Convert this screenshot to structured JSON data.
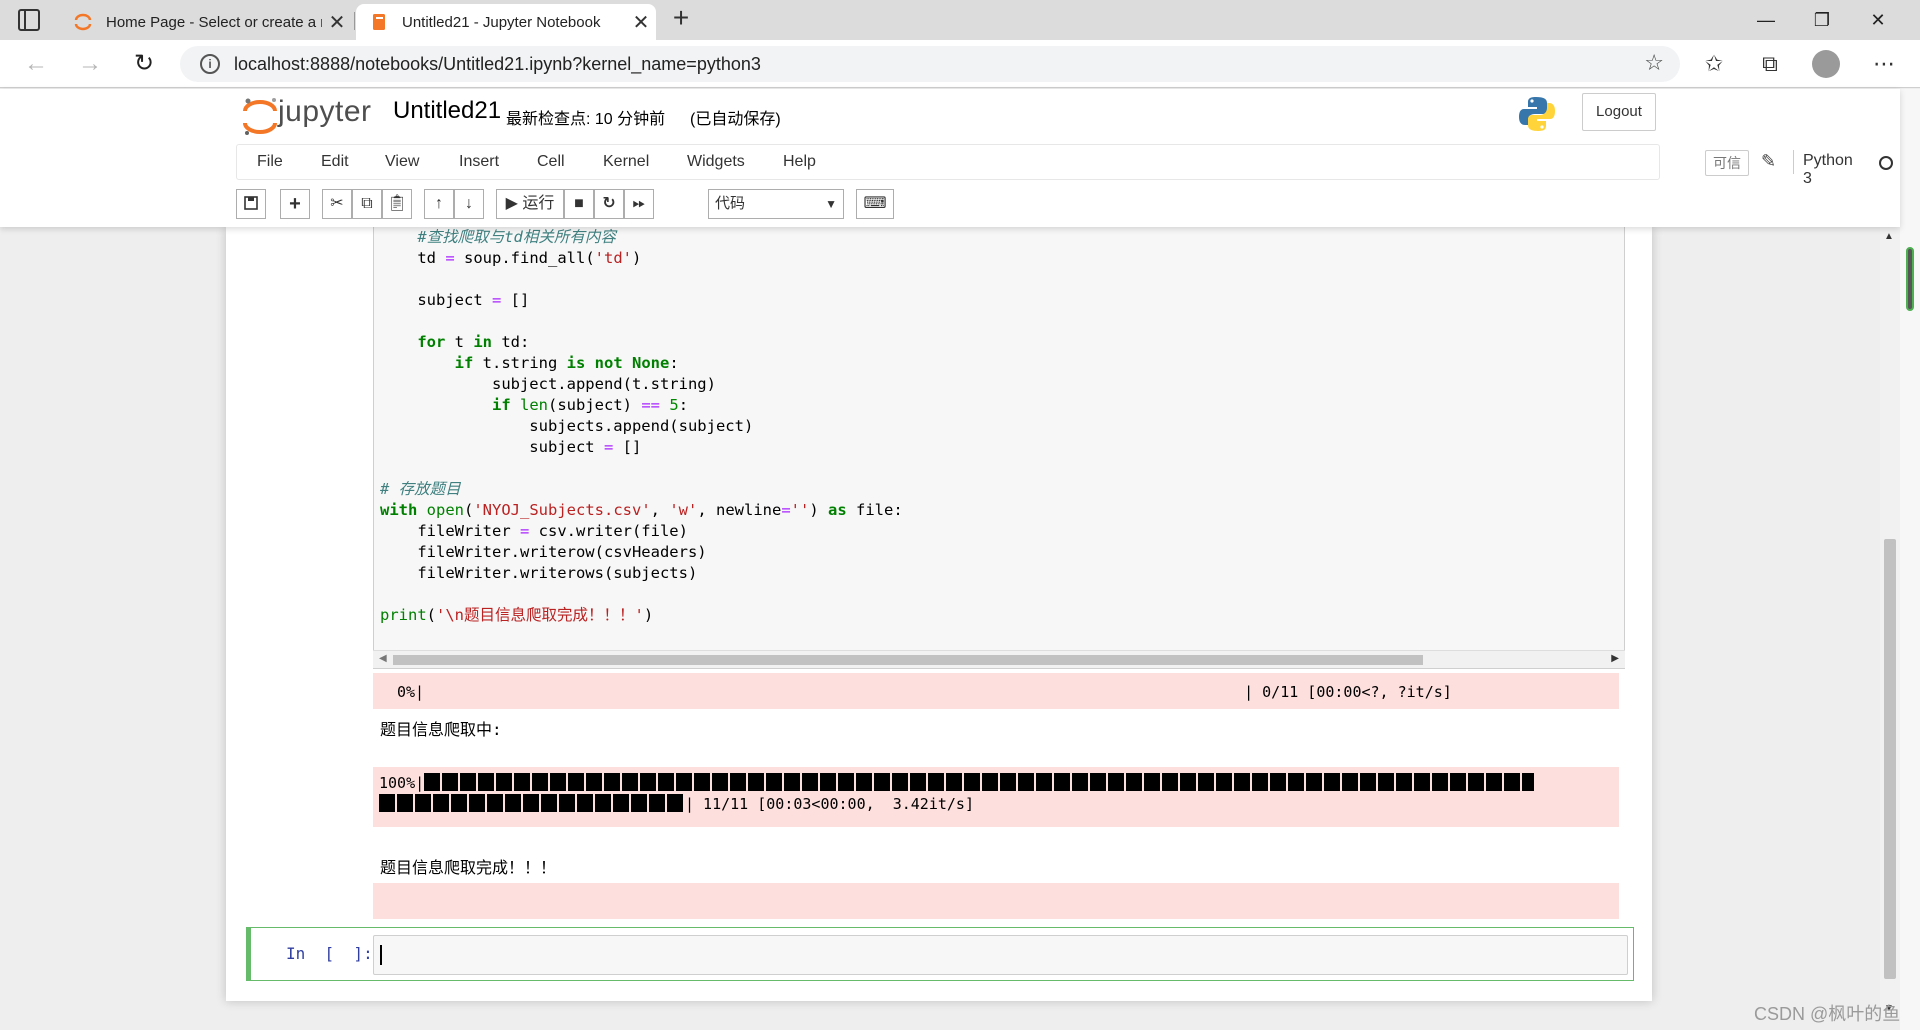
{
  "browser": {
    "tabs": [
      {
        "title": "Home Page - Select or create a n",
        "active": false
      },
      {
        "title": "Untitled21 - Jupyter Notebook",
        "active": true
      }
    ],
    "url": "localhost:8888/notebooks/Untitled21.ipynb?kernel_name=python3",
    "new_tab": "+",
    "close": "✕",
    "window_controls": {
      "minimize": "—",
      "maximize": "❐",
      "close": "✕"
    }
  },
  "jupyter": {
    "logo_text": "jupyter",
    "notebook_title": "Untitled21",
    "checkpoint": "最新检查点: 10 分钟前",
    "autosave": "(已自动保存)",
    "logout": "Logout",
    "menu": [
      "File",
      "Edit",
      "View",
      "Insert",
      "Cell",
      "Kernel",
      "Widgets",
      "Help"
    ],
    "trusted": "可信",
    "kernel": "Python 3",
    "toolbar": {
      "run_label": "运行",
      "cell_type": "代码"
    }
  },
  "cell": {
    "code_lines": [
      "#查找爬取与td相关所有内容",
      "td = soup.find_all('td')",
      "",
      "subject = []",
      "",
      "for t in td:",
      "    if t.string is not None:",
      "        subject.append(t.string)",
      "        if len(subject) == 5:",
      "            subjects.append(subject)",
      "            subject = []",
      "",
      "# 存放题目",
      "with open('NYOJ_Subjects.csv', 'w', newline='') as file:",
      "    fileWriter = csv.writer(file)",
      "    fileWriter.writerow(csvHeaders)",
      "    fileWriter.writerows(subjects)",
      "",
      "print('\\n题目信息爬取完成！！！')"
    ],
    "outputs": {
      "progress_start_pct": "0%|",
      "progress_start_stats": "| 0/11 [00:00<?, ?it/s]",
      "progress_start_value": 0,
      "crawling_msg": "题目信息爬取中:",
      "progress_end_pct": "100%|",
      "progress_end_stats": "| 11/11 [00:03<00:00,  3.42it/s]",
      "progress_end_value": 100,
      "done_msg": "题目信息爬取完成！！！"
    }
  },
  "new_cell": {
    "prompt": "In  [  ]:"
  },
  "watermark": "CSDN @枫叶的鱼"
}
